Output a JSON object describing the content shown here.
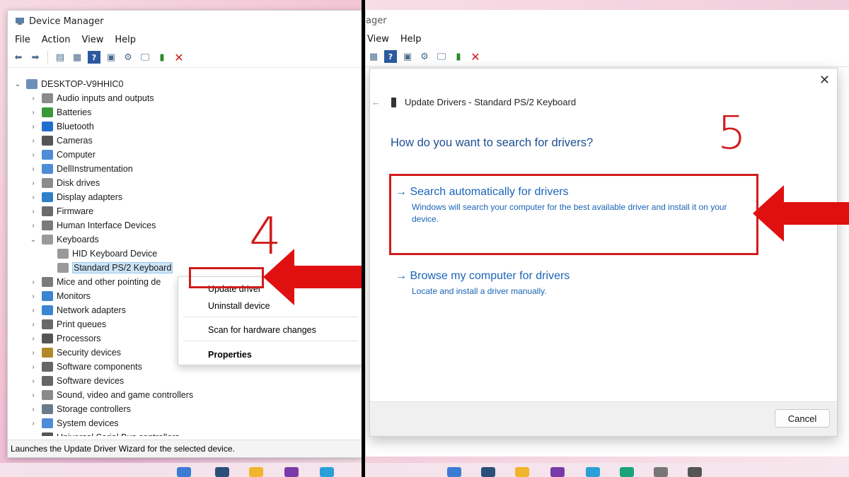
{
  "left": {
    "window_title": "Device Manager",
    "menu": [
      "File",
      "Action",
      "View",
      "Help"
    ],
    "root_node": "DESKTOP-V9HHIC0",
    "tree_items": [
      {
        "label": "Audio inputs and outputs",
        "icon": "speaker-icon"
      },
      {
        "label": "Batteries",
        "icon": "battery-icon"
      },
      {
        "label": "Bluetooth",
        "icon": "bluetooth-icon"
      },
      {
        "label": "Cameras",
        "icon": "camera-icon"
      },
      {
        "label": "Computer",
        "icon": "computer-icon"
      },
      {
        "label": "DellInstrumentation",
        "icon": "computer-icon"
      },
      {
        "label": "Disk drives",
        "icon": "disk-icon"
      },
      {
        "label": "Display adapters",
        "icon": "display-icon"
      },
      {
        "label": "Firmware",
        "icon": "firmware-icon"
      },
      {
        "label": "Human Interface Devices",
        "icon": "hid-icon"
      },
      {
        "label": "Keyboards",
        "icon": "keyboard-icon",
        "expanded": true
      },
      {
        "label": "HID Keyboard Device",
        "icon": "keyboard-icon",
        "child": true
      },
      {
        "label": "Standard PS/2 Keyboard",
        "icon": "keyboard-icon",
        "child": true,
        "selected": true
      },
      {
        "label": "Mice and other pointing de",
        "icon": "mouse-icon"
      },
      {
        "label": "Monitors",
        "icon": "monitor-icon"
      },
      {
        "label": "Network adapters",
        "icon": "network-icon"
      },
      {
        "label": "Print queues",
        "icon": "printer-icon"
      },
      {
        "label": "Processors",
        "icon": "processor-icon"
      },
      {
        "label": "Security devices",
        "icon": "security-icon"
      },
      {
        "label": "Software components",
        "icon": "software-icon"
      },
      {
        "label": "Software devices",
        "icon": "software-icon"
      },
      {
        "label": "Sound, video and game controllers",
        "icon": "speaker-icon"
      },
      {
        "label": "Storage controllers",
        "icon": "storage-icon"
      },
      {
        "label": "System devices",
        "icon": "system-icon"
      },
      {
        "label": "Universal Serial Bus controllers",
        "icon": "usb-icon"
      }
    ],
    "context_menu": {
      "update_driver": "Update driver",
      "uninstall_device": "Uninstall device",
      "scan": "Scan for hardware changes",
      "properties": "Properties"
    },
    "status_text": "Launches the Update Driver Wizard for the selected device.",
    "step_number": "4"
  },
  "right": {
    "partial_title": "ager",
    "menu": [
      "View",
      "Help"
    ],
    "dialog_heading": "Update Drivers - Standard PS/2 Keyboard",
    "question": "How do you want to search for drivers?",
    "option1_title": "Search automatically for drivers",
    "option1_desc": "Windows will search your computer for the best available driver and install it on your device.",
    "option2_title": "Browse my computer for drivers",
    "option2_desc": "Locate and install a driver manually.",
    "cancel_label": "Cancel",
    "step_number": "5"
  },
  "colors": {
    "highlight": "#d11b1b",
    "link": "#1a64b7"
  }
}
